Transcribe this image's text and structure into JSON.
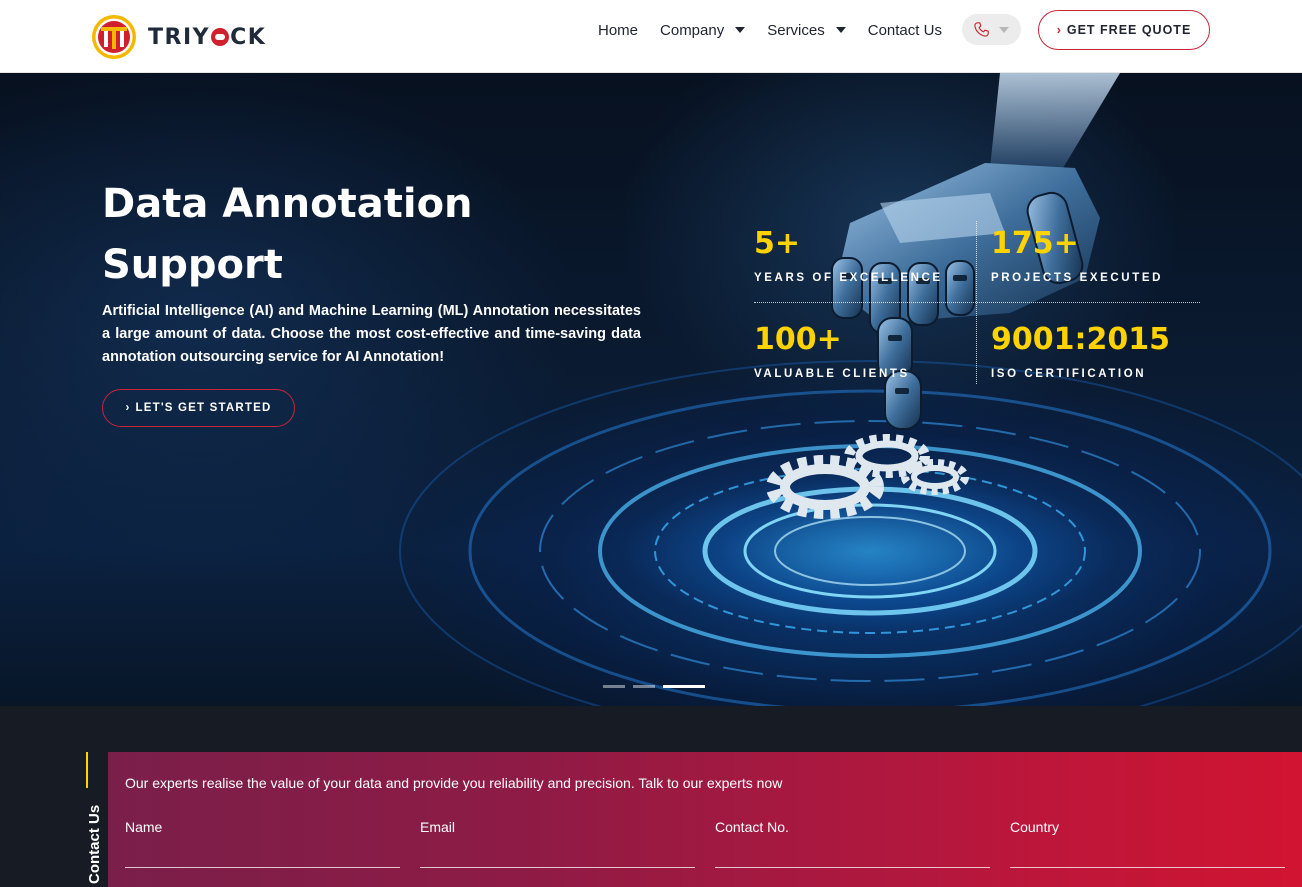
{
  "brand": {
    "name": "TRIYOCK",
    "name_prefix": "TRIY",
    "name_suffix": "CK",
    "accent": "#c8243a",
    "yellow": "#ffd200"
  },
  "nav": {
    "items": [
      {
        "label": "Home",
        "dropdown": false
      },
      {
        "label": "Company",
        "dropdown": true
      },
      {
        "label": "Services",
        "dropdown": true
      },
      {
        "label": "Contact Us",
        "dropdown": false
      }
    ],
    "phone_icon": "phone-icon",
    "quote_label": "GET FREE QUOTE"
  },
  "hero": {
    "title": "Data Annotation Support",
    "description": "Artificial Intelligence (AI) and Machine Learning (ML) Annotation necessitates a large amount of data. Choose the most cost-effective and time-saving data annotation outsourcing service for AI Annotation!",
    "cta_label": "LET'S GET STARTED",
    "stats": [
      {
        "number": "5+",
        "label": "YEARS OF EXCELLENCE"
      },
      {
        "number": "175+",
        "label": "PROJECTS EXECUTED"
      },
      {
        "number": "100+",
        "label": "VALUABLE CLIENTS"
      },
      {
        "number": "9001:2015",
        "label": "ISO CERTIFICATION"
      }
    ],
    "slides": {
      "count": 3,
      "active_index": 2
    }
  },
  "contact": {
    "tab_label": "Contact Us",
    "intro": "Our experts realise the value of your data and provide you reliability and precision. Talk to our experts now",
    "fields": [
      {
        "label": "Name",
        "value": ""
      },
      {
        "label": "Email",
        "value": ""
      },
      {
        "label": "Contact No.",
        "value": ""
      },
      {
        "label": "Country",
        "value": ""
      }
    ]
  }
}
